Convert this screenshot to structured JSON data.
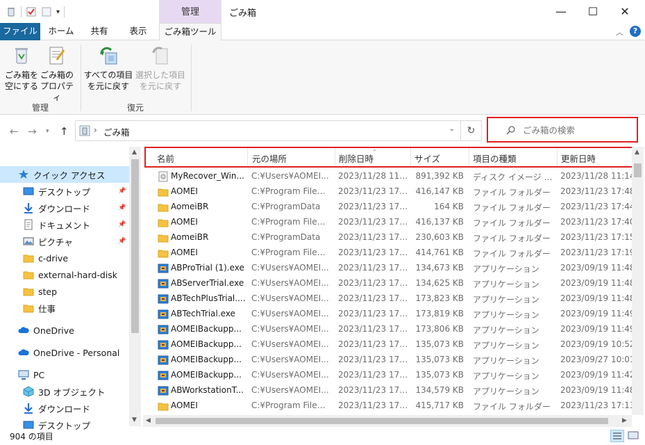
{
  "window": {
    "context_tab_header": "管理",
    "title": "ごみ箱",
    "minimize": "—",
    "maximize": "☐",
    "close": "✕"
  },
  "ribbon_tabs": [
    "ファイル",
    "ホーム",
    "共有",
    "表示",
    "ごみ箱ツール"
  ],
  "ribbon": {
    "groups": [
      {
        "label": "管理",
        "buttons": [
          {
            "line1": "ごみ箱を",
            "line2": "空にする",
            "icon": "empty-bin-icon"
          },
          {
            "line1": "ごみ箱の",
            "line2": "プロパティ",
            "icon": "properties-icon"
          }
        ]
      },
      {
        "label": "復元",
        "buttons": [
          {
            "line1": "すべての項目",
            "line2": "を元に戻す",
            "icon": "restore-all-icon"
          },
          {
            "line1": "選択した項目",
            "line2": "を元に戻す",
            "icon": "restore-selected-icon",
            "disabled": true
          }
        ]
      }
    ]
  },
  "address": {
    "location": "ごみ箱",
    "search_placeholder": "ごみ箱の検索"
  },
  "nav": {
    "items": [
      {
        "label": "クイック アクセス",
        "icon": "star-icon",
        "level": 0,
        "selected": true
      },
      {
        "label": "デスクトップ",
        "icon": "desktop-icon",
        "level": 1,
        "pinned": true
      },
      {
        "label": "ダウンロード",
        "icon": "download-icon",
        "level": 1,
        "pinned": true
      },
      {
        "label": "ドキュメント",
        "icon": "document-icon",
        "level": 1,
        "pinned": true
      },
      {
        "label": "ピクチャ",
        "icon": "picture-icon",
        "level": 1,
        "pinned": true
      },
      {
        "label": "c-drive",
        "icon": "folder-icon",
        "level": 1
      },
      {
        "label": "external-hard-disk",
        "icon": "folder-icon",
        "level": 1
      },
      {
        "label": "step",
        "icon": "folder-icon",
        "level": 1
      },
      {
        "label": "仕事",
        "icon": "folder-icon",
        "level": 1
      },
      {
        "label": "OneDrive",
        "icon": "cloud-icon",
        "level": 0
      },
      {
        "label": "OneDrive - Personal",
        "icon": "cloud-icon",
        "level": 0
      },
      {
        "label": "PC",
        "icon": "pc-icon",
        "level": 0
      },
      {
        "label": "3D オブジェクト",
        "icon": "cube-icon",
        "level": 1
      },
      {
        "label": "ダウンロード",
        "icon": "download-icon",
        "level": 1
      },
      {
        "label": "デスクトップ",
        "icon": "desktop-icon",
        "level": 1
      }
    ]
  },
  "columns": [
    "名前",
    "元の場所",
    "削除日時",
    "サイズ",
    "項目の種類",
    "更新日時"
  ],
  "rows": [
    {
      "name": "MyRecover_Win...",
      "loc": "C:¥Users¥AOMEI...",
      "del": "2023/11/28 11:...",
      "size": "891,392 KB",
      "type": "ディスク イメージ ファ...",
      "mod": "2023/11/28 11:14",
      "icon": "disc-image"
    },
    {
      "name": "AOMEI",
      "loc": "C:¥Program Files ...",
      "del": "2023/11/23 17:...",
      "size": "416,147 KB",
      "type": "ファイル フォルダー",
      "mod": "2023/11/23 17:48",
      "icon": "folder"
    },
    {
      "name": "AomeiBR",
      "loc": "C:¥ProgramData",
      "del": "2023/11/23 17:...",
      "size": "164 KB",
      "type": "ファイル フォルダー",
      "mod": "2023/11/23 17:44",
      "icon": "folder"
    },
    {
      "name": "AOMEI",
      "loc": "C:¥Program Files ...",
      "del": "2023/11/23 17:...",
      "size": "416,137 KB",
      "type": "ファイル フォルダー",
      "mod": "2023/11/23 17:40",
      "icon": "folder"
    },
    {
      "name": "AomeiBR",
      "loc": "C:¥ProgramData",
      "del": "2023/11/23 17:...",
      "size": "230,603 KB",
      "type": "ファイル フォルダー",
      "mod": "2023/11/23 17:15",
      "icon": "folder"
    },
    {
      "name": "AOMEI",
      "loc": "C:¥Program Files ...",
      "del": "2023/11/23 17:...",
      "size": "414,761 KB",
      "type": "ファイル フォルダー",
      "mod": "2023/11/23 17:19",
      "icon": "folder"
    },
    {
      "name": "ABProTrial (1).exe",
      "loc": "C:¥Users¥AOMEI...",
      "del": "2023/11/23 17:...",
      "size": "134,673 KB",
      "type": "アプリケーション",
      "mod": "2023/09/19 11:48",
      "icon": "app"
    },
    {
      "name": "ABServerTrial.exe",
      "loc": "C:¥Users¥AOMEI...",
      "del": "2023/11/23 17:...",
      "size": "134,625 KB",
      "type": "アプリケーション",
      "mod": "2023/09/19 11:48",
      "icon": "app"
    },
    {
      "name": "ABTechPlusTrial....",
      "loc": "C:¥Users¥AOMEI...",
      "del": "2023/11/23 17:...",
      "size": "173,823 KB",
      "type": "アプリケーション",
      "mod": "2023/09/19 11:48",
      "icon": "app"
    },
    {
      "name": "ABTechTrial.exe",
      "loc": "C:¥Users¥AOMEI...",
      "del": "2023/11/23 17:...",
      "size": "173,819 KB",
      "type": "アプリケーション",
      "mod": "2023/09/19 11:49",
      "icon": "app"
    },
    {
      "name": "AOMEIBackupp...",
      "loc": "C:¥Users¥AOMEI...",
      "del": "2023/11/23 17:...",
      "size": "173,806 KB",
      "type": "アプリケーション",
      "mod": "2023/09/19 11:49",
      "icon": "app"
    },
    {
      "name": "AOMEIBackupp...",
      "loc": "C:¥Users¥AOMEI...",
      "del": "2023/11/23 17:...",
      "size": "135,073 KB",
      "type": "アプリケーション",
      "mod": "2023/09/19 10:52",
      "icon": "app"
    },
    {
      "name": "AOMEIBackupp...",
      "loc": "C:¥Users¥AOMEI...",
      "del": "2023/11/23 17:...",
      "size": "135,073 KB",
      "type": "アプリケーション",
      "mod": "2023/09/27 10:01",
      "icon": "app"
    },
    {
      "name": "AOMEIBackupp...",
      "loc": "C:¥Users¥AOMEI...",
      "del": "2023/11/23 17:...",
      "size": "135,073 KB",
      "type": "アプリケーション",
      "mod": "2023/09/19 11:42",
      "icon": "app"
    },
    {
      "name": "ABWorkstationT...",
      "loc": "C:¥Users¥AOMEI...",
      "del": "2023/11/23 17:...",
      "size": "134,579 KB",
      "type": "アプリケーション",
      "mod": "2023/09/19 11:48",
      "icon": "app"
    },
    {
      "name": "AOMEI",
      "loc": "C:¥Program Files ...",
      "del": "2023/11/23 17:...",
      "size": "415,717 KB",
      "type": "ファイル フォルダー",
      "mod": "2023/11/23 17:13",
      "icon": "folder"
    }
  ],
  "status": {
    "count": "904 の項目"
  },
  "colors": {
    "accent": "#19689e",
    "context_tab": "#e8d9f2",
    "highlight_box": "#e02020",
    "selection": "#cce8ff",
    "folder": "#f5c242"
  }
}
